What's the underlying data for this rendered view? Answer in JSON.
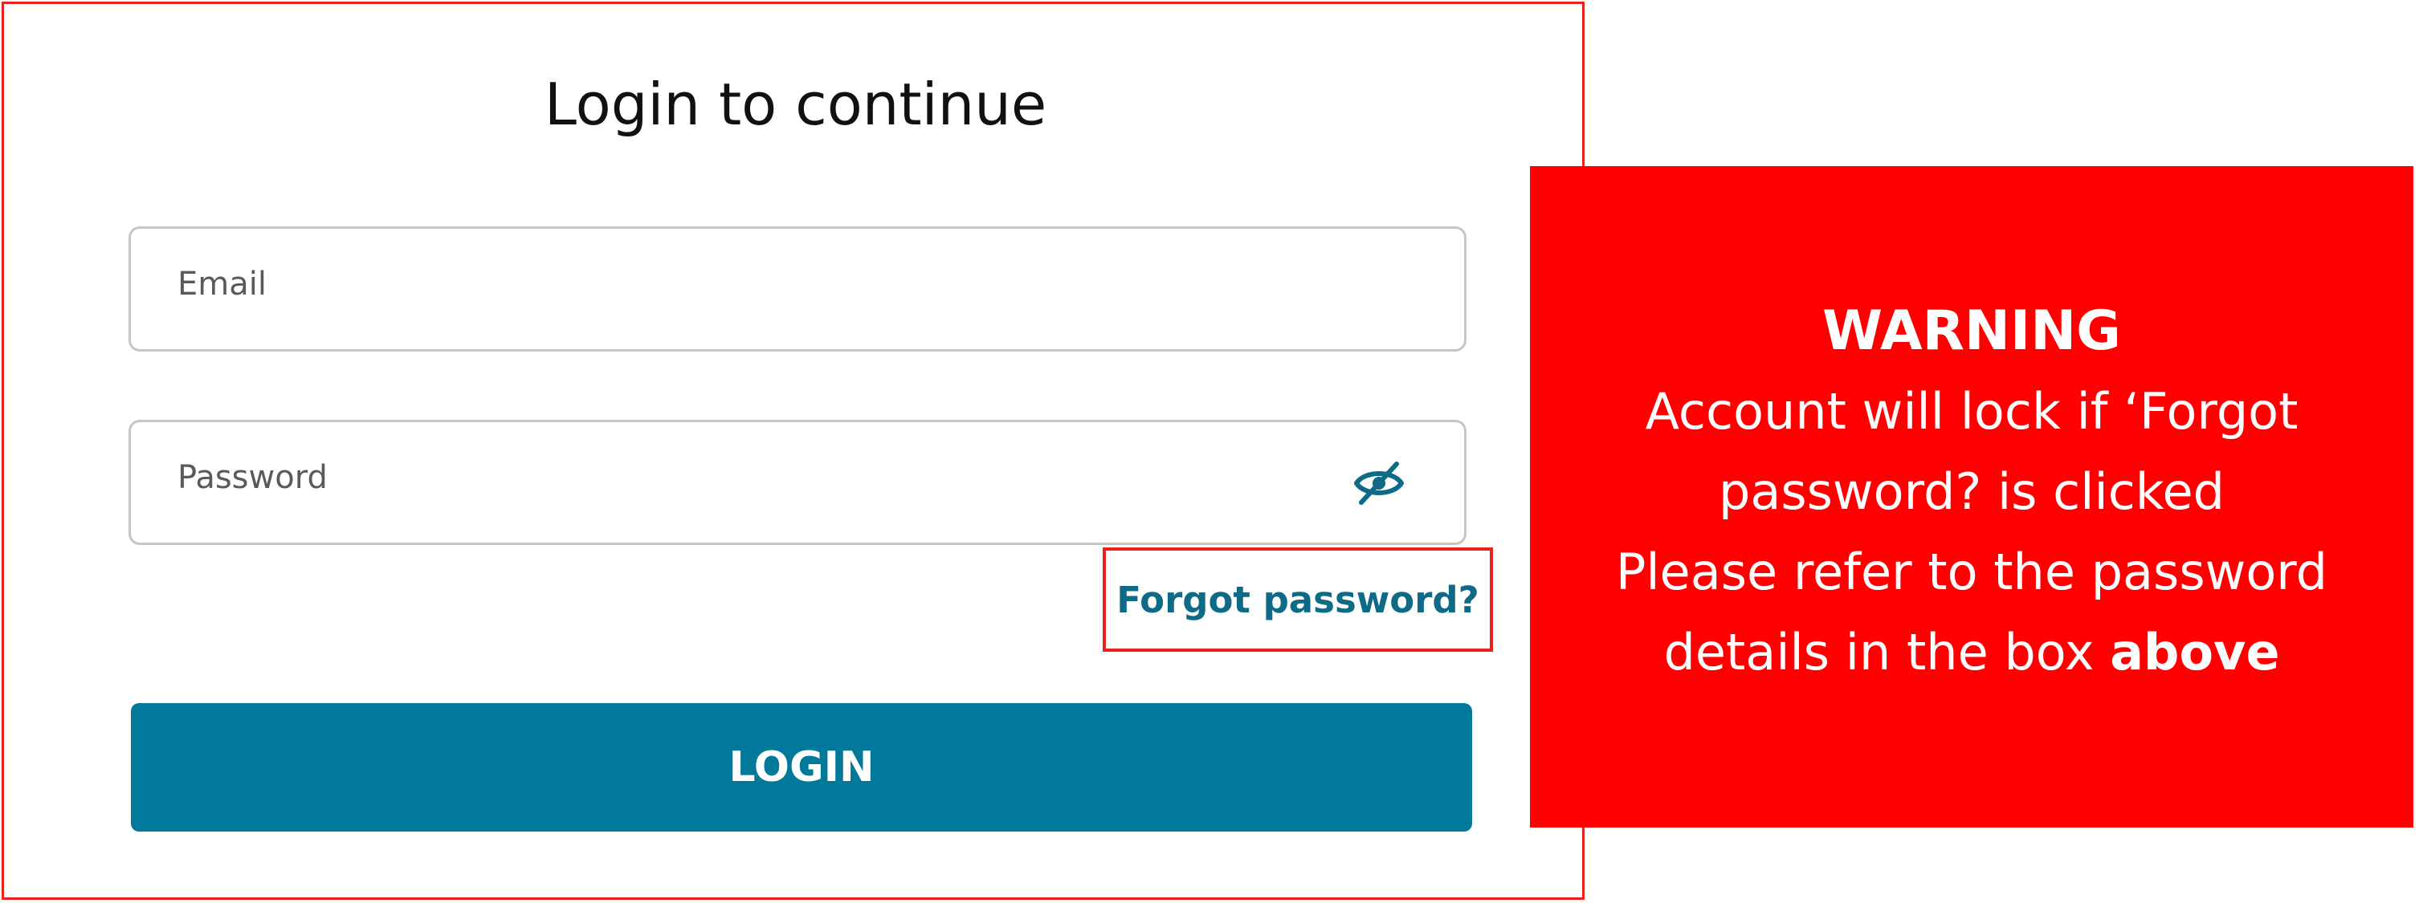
{
  "login": {
    "title": "Login to continue",
    "email_placeholder": "Email",
    "password_placeholder": "Password",
    "password_visibility_icon": "eye-slash-icon",
    "forgot_label": "Forgot password?",
    "login_label": "LOGIN"
  },
  "warning": {
    "title": "WARNING",
    "line1": "Account will lock if ‘Forgot",
    "line2": "password? is clicked",
    "line3": "Please refer to the password",
    "line4_prefix": "details in the box ",
    "line4_bold": "above"
  },
  "colors": {
    "highlight_border": "#e8231d",
    "login_button": "#02799a",
    "link": "#0e6a86",
    "warning_background": "#ff0000",
    "warning_text": "#ffffff"
  }
}
